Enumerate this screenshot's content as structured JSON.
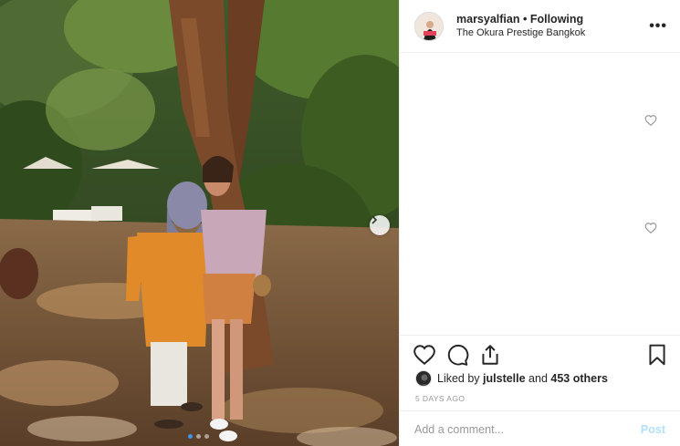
{
  "post": {
    "username": "marsyalfian",
    "separator": "•",
    "follow_status": "Following",
    "location": "The Okura Prestige Bangkok",
    "more_label": "•••"
  },
  "carousel": {
    "total_slides": 3,
    "active_slide": 1
  },
  "likes": {
    "prefix": "Liked by ",
    "user": "julstelle",
    "middle": " and ",
    "others": "453 others"
  },
  "timestamp": "5 DAYS AGO",
  "comment_box": {
    "placeholder": "Add a comment...",
    "post_label": "Post"
  },
  "colors": {
    "link_blue": "#3897f0",
    "post_disabled": "#b2dffc"
  },
  "icons": [
    "heart-icon",
    "comment-icon",
    "share-icon",
    "bookmark-icon",
    "chevron-right-icon",
    "more-icon"
  ]
}
